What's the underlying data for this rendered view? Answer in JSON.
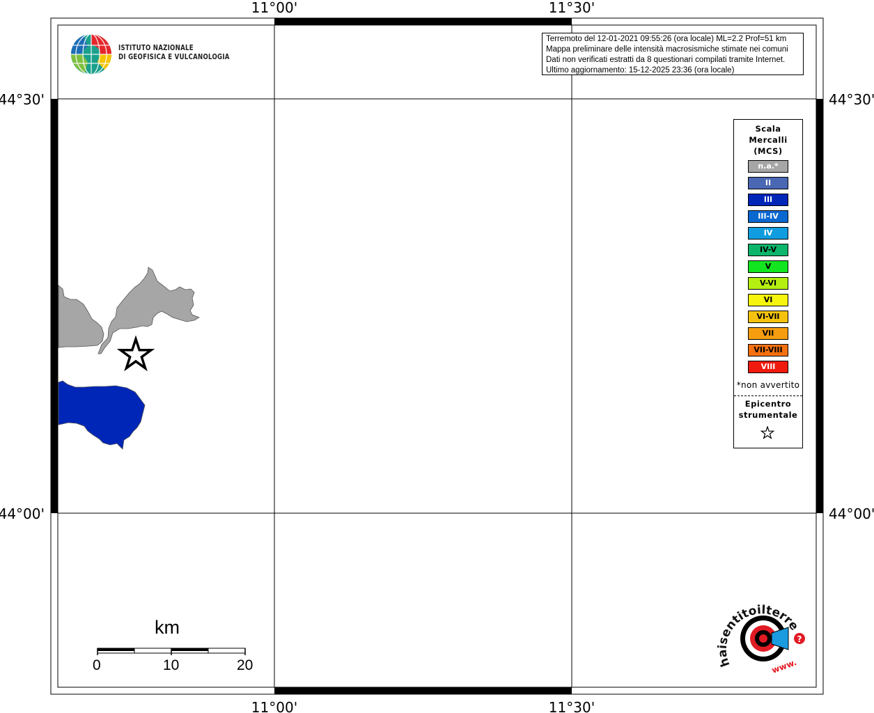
{
  "map": {
    "lon_ticks": [
      "11°00'",
      "11°30'"
    ],
    "lat_ticks": [
      "44°30'",
      "44°00'"
    ],
    "colors": {
      "na": "#a6a6a6",
      "III": "#0026b8",
      "frame": "#000000"
    }
  },
  "logo": {
    "line1": "ISTITUTO NAZIONALE",
    "line2": "DI GEOFISICA E VULCANOLOGIA"
  },
  "info": {
    "line1": "Terremoto del 12-01-2021 09:55:26 (ora locale) ML=2.2 Prof=51 km",
    "line2": "Mappa preliminare delle intensità macrosismiche stimate nei comuni",
    "line3": "Dati non verificati estratti da 8 questionari compilati tramite Internet.",
    "line4": "Ultimo aggiornamento: 15-12-2025 23:36 (ora locale)"
  },
  "legend": {
    "title1": "Scala",
    "title2": "Mercalli",
    "title3": "(MCS)",
    "items": [
      {
        "label": "n.a.*",
        "color": "#a6a6a6",
        "text_color": "#ffffff"
      },
      {
        "label": "II",
        "color": "#4a67b3",
        "text_color": "#ffffff"
      },
      {
        "label": "III",
        "color": "#0026b8",
        "text_color": "#ffffff"
      },
      {
        "label": "III-IV",
        "color": "#0a68d1",
        "text_color": "#ffffff"
      },
      {
        "label": "IV",
        "color": "#109de0",
        "text_color": "#ffffff"
      },
      {
        "label": "IV-V",
        "color": "#0db56b",
        "text_color": "#000000"
      },
      {
        "label": "V",
        "color": "#12e51f",
        "text_color": "#000000"
      },
      {
        "label": "V-VI",
        "color": "#b5ef12",
        "text_color": "#000000"
      },
      {
        "label": "VI",
        "color": "#f5f50e",
        "text_color": "#000000"
      },
      {
        "label": "VI-VII",
        "color": "#f5c30f",
        "text_color": "#000000"
      },
      {
        "label": "VII",
        "color": "#f59d0f",
        "text_color": "#000000"
      },
      {
        "label": "VII-VIII",
        "color": "#f5700f",
        "text_color": "#000000"
      },
      {
        "label": "VIII",
        "color": "#f01a0e",
        "text_color": "#ffffff"
      }
    ],
    "note": "*non avvertito",
    "epicentre1": "Epicentro",
    "epicentre2": "strumentale",
    "epicentre_symbol": "star-icon"
  },
  "scale_bar": {
    "unit": "km",
    "labels": [
      "0",
      "10",
      "20"
    ]
  },
  "hst": {
    "text": "haisentitoilterremoto.it",
    "prefix": "www."
  }
}
